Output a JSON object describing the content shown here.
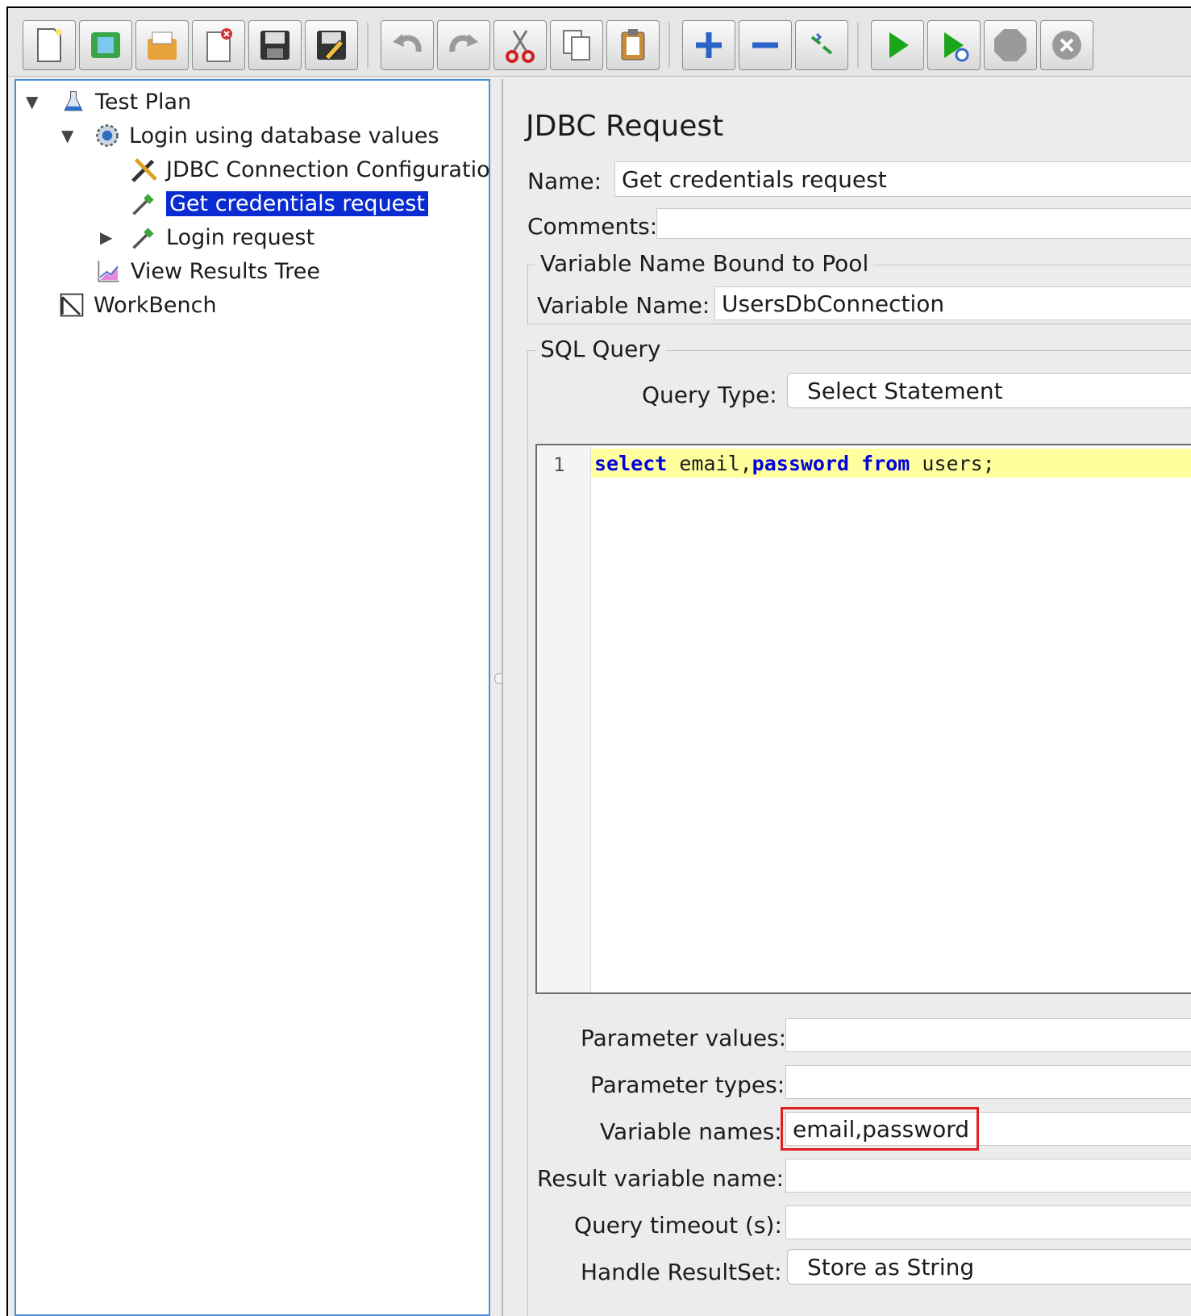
{
  "toolbar": {
    "buttons": [
      {
        "icon": "new-file-icon"
      },
      {
        "icon": "templates-icon"
      },
      {
        "icon": "open-icon"
      },
      {
        "icon": "close-icon"
      },
      {
        "icon": "save-icon"
      },
      {
        "icon": "save-as-icon"
      },
      {
        "icon": "undo-icon"
      },
      {
        "icon": "redo-icon"
      },
      {
        "icon": "cut-icon"
      },
      {
        "icon": "copy-icon"
      },
      {
        "icon": "paste-icon"
      },
      {
        "icon": "expand-icon"
      },
      {
        "icon": "collapse-icon"
      },
      {
        "icon": "toggle-icon"
      },
      {
        "icon": "start-icon"
      },
      {
        "icon": "start-no-timers-icon"
      },
      {
        "icon": "stop-icon"
      },
      {
        "icon": "shutdown-icon"
      }
    ]
  },
  "tree": {
    "items": [
      {
        "label": "Test Plan",
        "icon": "flask-icon",
        "twisty": "▼"
      },
      {
        "label": "Login using database values",
        "icon": "gear-icon",
        "twisty": "▼"
      },
      {
        "label": "JDBC Connection Configuration",
        "icon": "wrench-icon",
        "twisty": ""
      },
      {
        "label": "Get credentials request",
        "icon": "pipette-icon",
        "twisty": "",
        "selected": true
      },
      {
        "label": "Login request",
        "icon": "pipette-icon",
        "twisty": "▶"
      },
      {
        "label": "View Results Tree",
        "icon": "chart-icon",
        "twisty": ""
      },
      {
        "label": "WorkBench",
        "icon": "workbench-icon",
        "twisty": ""
      }
    ]
  },
  "panel": {
    "title": "JDBC Request",
    "name_label": "Name:",
    "name_value": "Get credentials request",
    "comments_label": "Comments:",
    "comments_value": "",
    "pool_group": "Variable Name Bound to Pool",
    "variable_name_label": "Variable Name:",
    "variable_name_value": "UsersDbConnection",
    "sql_group": "SQL Query",
    "query_type_label": "Query Type:",
    "query_type_value": "Select Statement",
    "query_line_number": "1",
    "query_tokens": [
      {
        "text": "select",
        "kw": true
      },
      {
        "text": " email,",
        "kw": false
      },
      {
        "text": "password",
        "kw": true
      },
      {
        "text": " ",
        "kw": false
      },
      {
        "text": "from",
        "kw": true
      },
      {
        "text": " users;",
        "kw": false
      }
    ],
    "param_values_label": "Parameter values:",
    "param_values_value": "",
    "param_types_label": "Parameter types:",
    "param_types_value": "",
    "variable_names_label": "Variable names:",
    "variable_names_value": "email,password",
    "result_var_label": "Result variable name:",
    "result_var_value": "",
    "timeout_label": "Query timeout (s):",
    "timeout_value": "",
    "handle_resultset_label": "Handle ResultSet:",
    "handle_resultset_value": "Store as String"
  },
  "colors": {
    "selection": "#0a2bd1",
    "highlight_box": "#e02020",
    "keyword": "#0000e0",
    "current_line": "#ffff9e"
  }
}
